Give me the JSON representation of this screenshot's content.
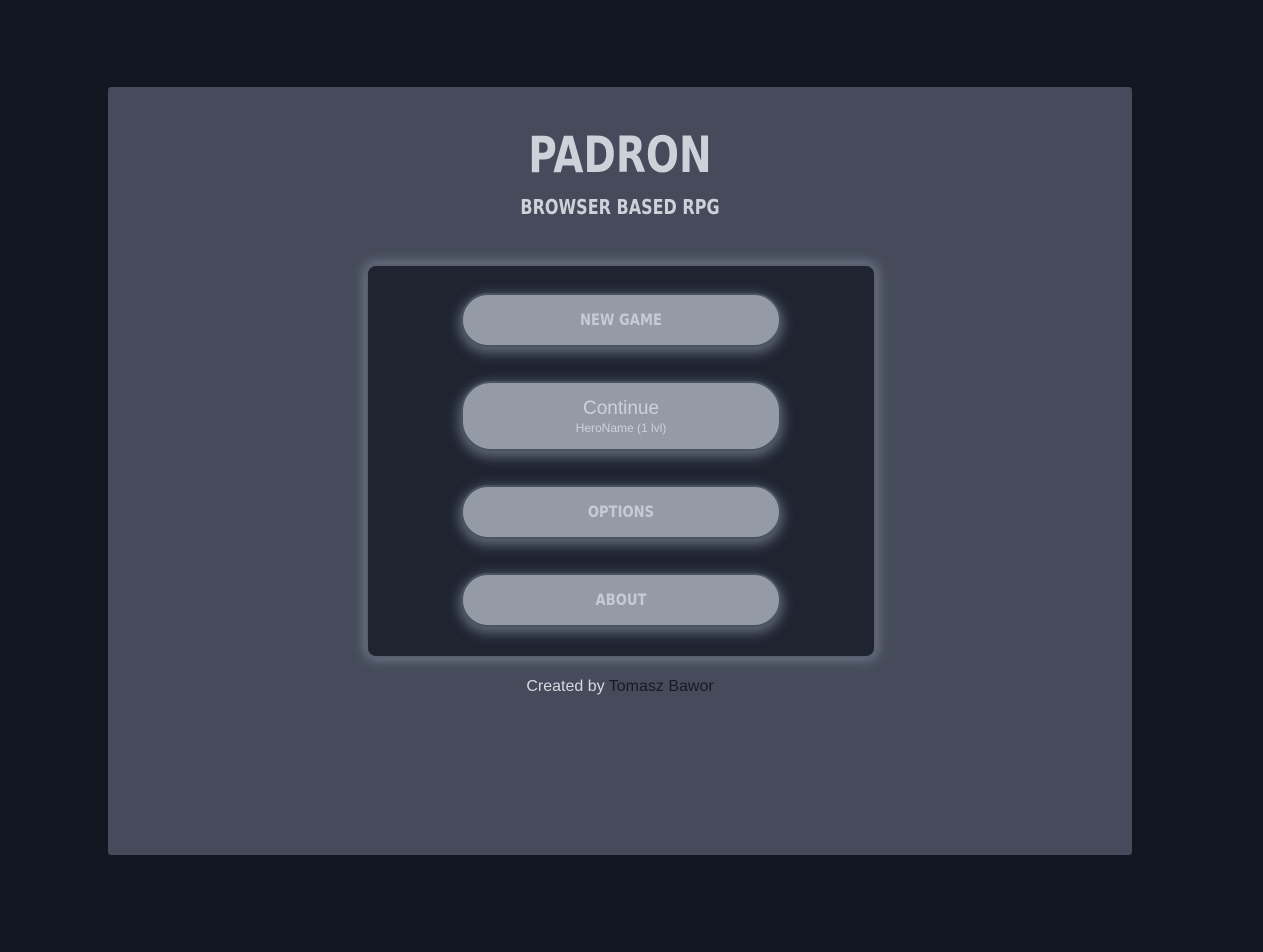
{
  "header": {
    "title": "PADRON",
    "subtitle": "BROWSER BASED RPG"
  },
  "menu": {
    "new_game": "NEW GAME",
    "continue_label": "Continue",
    "continue_hero": "HeroName (1 lvl)",
    "options": "OPTIONS",
    "about": "ABOUT"
  },
  "footer": {
    "created_by": "Created by",
    "author": "Tomasz Bawor"
  },
  "colors": {
    "background": "#131722",
    "panel": "#454b5a",
    "menu_box": "#1f2431",
    "button": "#949aa6",
    "text": "#cdd1d9",
    "author_link": "#151a26"
  }
}
